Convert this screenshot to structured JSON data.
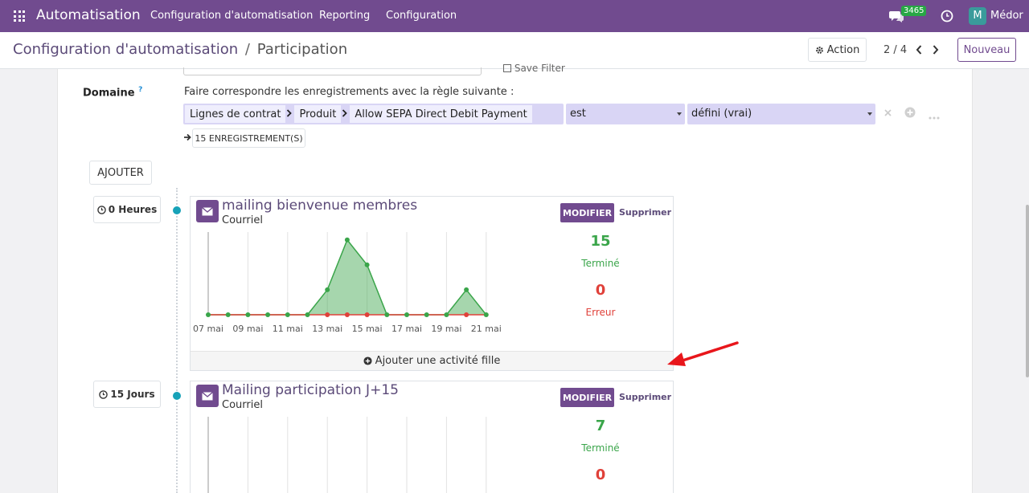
{
  "topbar": {
    "app_name": "Automatisation",
    "menu": [
      "Configuration d'automatisation",
      "Reporting",
      "Configuration"
    ],
    "badge": "3465",
    "avatar_letter": "M",
    "user": "Médor"
  },
  "controlbar": {
    "breadcrumb_root": "Configuration d'automatisation",
    "breadcrumb_sep": "/",
    "breadcrumb_current": "Participation",
    "action_label": "Action",
    "pager": "2 / 4",
    "new_label": "Nouveau"
  },
  "form": {
    "save_filter": "Save Filter",
    "domain_label": "Domaine",
    "domain_help": "?",
    "domain_text": "Faire correspondre les enregistrements avec la règle suivante :",
    "path": [
      "Lignes de contrat",
      "Produit",
      "Allow SEPA Direct Debit Payment"
    ],
    "operator": "est",
    "value": "défini (vrai)",
    "records_label": "15 ENREGISTREMENT(S)",
    "add_label": "AJOUTER"
  },
  "activities": [
    {
      "delay": "0 Heures",
      "title": "mailing bienvenue membres",
      "subtitle": "Courriel",
      "modify_label": "MODIFIER",
      "delete_label": "Supprimer",
      "done_count": "15",
      "done_label": "Terminé",
      "error_count": "0",
      "error_label": "Erreur",
      "footer_label": "Ajouter une activité fille"
    },
    {
      "delay": "15 Jours",
      "title": "Mailing participation J+15",
      "subtitle": "Courriel",
      "modify_label": "MODIFIER",
      "delete_label": "Supprimer",
      "done_count": "7",
      "done_label": "Terminé",
      "error_count": "0"
    }
  ],
  "chart_data": {
    "type": "area",
    "x": [
      "07 mai",
      "08 mai",
      "09 mai",
      "10 mai",
      "11 mai",
      "12 mai",
      "13 mai",
      "14 mai",
      "15 mai",
      "16 mai",
      "17 mai",
      "18 mai",
      "19 mai",
      "20 mai",
      "21 mai"
    ],
    "tick_labels": [
      "07 mai",
      "09 mai",
      "11 mai",
      "13 mai",
      "15 mai",
      "17 mai",
      "19 mai",
      "21 mai"
    ],
    "series": [
      {
        "values": [
          0,
          0,
          0,
          0,
          0,
          0,
          4,
          12,
          8,
          0,
          0,
          0,
          0,
          4,
          0
        ],
        "color": "#3aa54a"
      },
      {
        "values": [
          0,
          0,
          0,
          0,
          0,
          0,
          0,
          0,
          0,
          0,
          0,
          0,
          0,
          0,
          0
        ],
        "color": "#e0413a"
      }
    ],
    "ylim": [
      0,
      13
    ]
  },
  "colors": {
    "brand": "#714b8f",
    "success": "#3aa54a",
    "danger": "#e0413a",
    "timeline_dot": "#17a2b8"
  }
}
